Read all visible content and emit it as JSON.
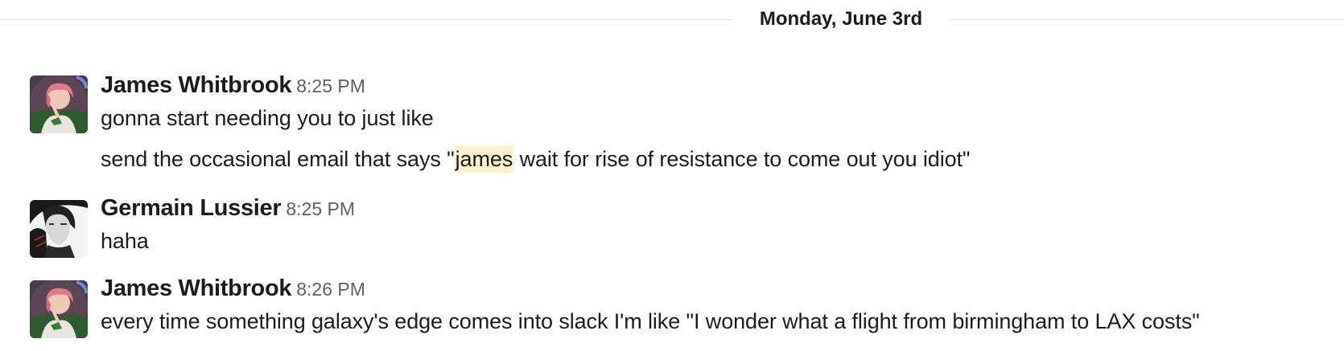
{
  "day_divider": {
    "label": "Monday, June 3rd"
  },
  "messages": [
    {
      "sender": "James Whitbrook",
      "time": "8:25 PM",
      "lines": [
        {
          "text": "gonna start needing you to just like"
        },
        {
          "before": "send the occasional email that says \"",
          "mention": "james",
          "after": " wait for rise of resistance to come out you idiot\""
        }
      ]
    },
    {
      "sender": "Germain Lussier",
      "time": "8:25 PM",
      "lines": [
        {
          "text": "haha"
        }
      ]
    },
    {
      "sender": "James Whitbrook",
      "time": "8:26 PM",
      "lines": [
        {
          "text": "every time something galaxy's edge comes into slack I'm like \"I wonder what a flight from birmingham to LAX costs\""
        }
      ]
    }
  ],
  "colors": {
    "highlight": "#fdf2d0",
    "timestamp": "#616061",
    "divider_line": "#dddddd"
  }
}
